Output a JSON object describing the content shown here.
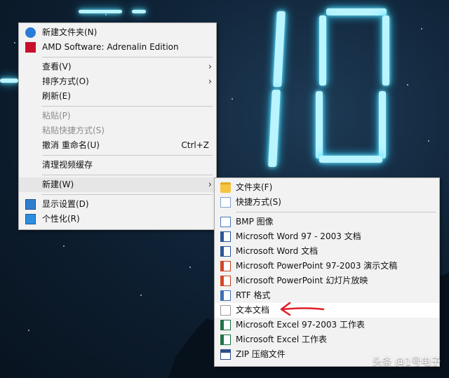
{
  "context_menu": {
    "items": [
      {
        "label": "新建文件夹(N)"
      },
      {
        "label": "AMD Software: Adrenalin Edition"
      },
      {
        "label": "查看(V)"
      },
      {
        "label": "排序方式(O)"
      },
      {
        "label": "刷新(E)"
      },
      {
        "label": "粘贴(P)"
      },
      {
        "label": "粘贴快捷方式(S)"
      },
      {
        "label": "撤消 重命名(U)",
        "shortcut": "Ctrl+Z"
      },
      {
        "label": "清理视频缓存"
      },
      {
        "label": "新建(W)"
      },
      {
        "label": "显示设置(D)"
      },
      {
        "label": "个性化(R)"
      }
    ]
  },
  "new_submenu": {
    "items": [
      {
        "label": "文件夹(F)",
        "icon": "folder-icon"
      },
      {
        "label": "快捷方式(S)",
        "icon": "shortcut-icon"
      },
      {
        "label": "BMP 图像",
        "icon": "bmp-image-icon"
      },
      {
        "label": "Microsoft Word 97 - 2003 文档",
        "icon": "word-icon"
      },
      {
        "label": "Microsoft Word 文档",
        "icon": "word-icon"
      },
      {
        "label": "Microsoft PowerPoint 97-2003 演示文稿",
        "icon": "powerpoint-icon"
      },
      {
        "label": "Microsoft PowerPoint 幻灯片放映",
        "icon": "powerpoint-icon"
      },
      {
        "label": "RTF 格式",
        "icon": "rtf-icon"
      },
      {
        "label": "文本文档",
        "icon": "text-document-icon"
      },
      {
        "label": "Microsoft Excel 97-2003 工作表",
        "icon": "excel-icon"
      },
      {
        "label": "Microsoft Excel 工作表",
        "icon": "excel-icon"
      },
      {
        "label": "ZIP 压缩文件",
        "icon": "zip-icon"
      }
    ]
  },
  "watermark": {
    "text": "头条 @1号电子"
  },
  "colors": {
    "menu_bg": "#f2f2f2",
    "highlight": "#ffffff",
    "annotation_arrow": "#e0202a",
    "neon": "#b9f4ff"
  }
}
